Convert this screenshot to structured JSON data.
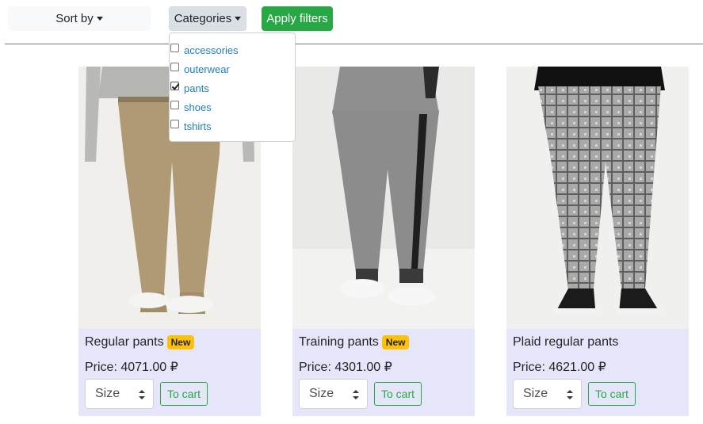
{
  "toolbar": {
    "sort_label": "Sort by",
    "categories_label": "Categories",
    "apply_label": "Apply filters"
  },
  "categories_menu": {
    "items": [
      {
        "label": "accessories",
        "checked": false
      },
      {
        "label": "outerwear",
        "checked": false
      },
      {
        "label": "pants",
        "checked": true
      },
      {
        "label": "shoes",
        "checked": false
      },
      {
        "label": "tshirts",
        "checked": false
      }
    ]
  },
  "products": [
    {
      "title": "Regular pants",
      "badge": "New",
      "price": "Price: 4071.00 ₽",
      "size_placeholder": "Size",
      "cart_label": "To cart"
    },
    {
      "title": "Training pants",
      "badge": "New",
      "price": "Price: 4301.00 ₽",
      "size_placeholder": "Size",
      "cart_label": "To cart"
    },
    {
      "title": "Plaid regular pants",
      "badge": "",
      "price": "Price: 4621.00 ₽",
      "size_placeholder": "Size",
      "cart_label": "To cart"
    }
  ],
  "colors": {
    "apply_button": "#28a745",
    "card_background": "#e6e6fa",
    "badge": "#ffc107",
    "link": "#1e7fbe"
  }
}
